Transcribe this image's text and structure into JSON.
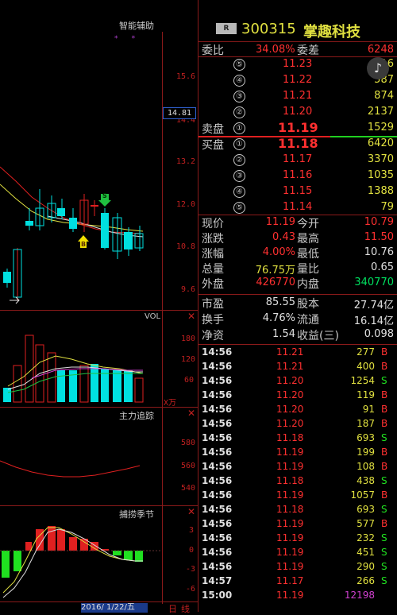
{
  "stock": {
    "badge": "R",
    "code": "300315",
    "name": "掌趣科技"
  },
  "weibi": {
    "label1": "委比",
    "pct": "34.08%",
    "label2": "委差",
    "diff": "6248"
  },
  "sell": [
    {
      "lvl": "⑤",
      "price": "11.23",
      "vol": "116"
    },
    {
      "lvl": "④",
      "price": "11.22",
      "vol": "587"
    },
    {
      "lvl": "③",
      "price": "11.21",
      "vol": "874"
    },
    {
      "lvl": "②",
      "price": "11.20",
      "vol": "2137"
    },
    {
      "lvl": "①",
      "price": "11.19",
      "vol": "1529",
      "label": "卖盘"
    }
  ],
  "buy": [
    {
      "lvl": "①",
      "price": "11.18",
      "vol": "6420",
      "label": "买盘"
    },
    {
      "lvl": "②",
      "price": "11.17",
      "vol": "3370"
    },
    {
      "lvl": "③",
      "price": "11.16",
      "vol": "1035"
    },
    {
      "lvl": "④",
      "price": "11.15",
      "vol": "1388"
    },
    {
      "lvl": "⑤",
      "price": "11.14",
      "vol": "79"
    }
  ],
  "quote": [
    {
      "l1": "现价",
      "v1": "11.19",
      "l2": "今开",
      "v2": "10.79"
    },
    {
      "l1": "涨跌",
      "v1": "0.43",
      "l2": "最高",
      "v2": "11.50"
    },
    {
      "l1": "涨幅",
      "v1": "4.00%",
      "l2": "最低",
      "v2": "10.76"
    },
    {
      "l1": "总量",
      "v1": "76.75万",
      "l2": "量比",
      "v2": "0.65"
    },
    {
      "l1": "外盘",
      "v1": "426770",
      "l2": "内盘",
      "v2": "340770"
    }
  ],
  "fin": [
    {
      "l1": "市盈",
      "v1": "85.55",
      "l2": "股本",
      "v2": "27.74亿"
    },
    {
      "l1": "换手",
      "v1": "4.76%",
      "l2": "流通",
      "v2": "16.14亿"
    },
    {
      "l1": "净资",
      "v1": "1.54",
      "l2": "收益(三)",
      "v2": "0.098"
    }
  ],
  "trades": [
    {
      "t": "14:56",
      "p": "11.21",
      "v": "277",
      "s": "B"
    },
    {
      "t": "14:56",
      "p": "11.21",
      "v": "400",
      "s": "B"
    },
    {
      "t": "14:56",
      "p": "11.20",
      "v": "1254",
      "s": "S"
    },
    {
      "t": "14:56",
      "p": "11.20",
      "v": "119",
      "s": "B"
    },
    {
      "t": "14:56",
      "p": "11.20",
      "v": "91",
      "s": "B"
    },
    {
      "t": "14:56",
      "p": "11.20",
      "v": "187",
      "s": "B"
    },
    {
      "t": "14:56",
      "p": "11.18",
      "v": "693",
      "s": "S"
    },
    {
      "t": "14:56",
      "p": "11.19",
      "v": "199",
      "s": "B"
    },
    {
      "t": "14:56",
      "p": "11.19",
      "v": "108",
      "s": "B"
    },
    {
      "t": "14:56",
      "p": "11.18",
      "v": "438",
      "s": "S"
    },
    {
      "t": "14:56",
      "p": "11.19",
      "v": "1057",
      "s": "B"
    },
    {
      "t": "14:56",
      "p": "11.18",
      "v": "693",
      "s": "S"
    },
    {
      "t": "14:56",
      "p": "11.19",
      "v": "577",
      "s": "B"
    },
    {
      "t": "14:56",
      "p": "11.19",
      "v": "232",
      "s": "S"
    },
    {
      "t": "14:56",
      "p": "11.19",
      "v": "451",
      "s": "S"
    },
    {
      "t": "14:56",
      "p": "11.19",
      "v": "290",
      "s": "S"
    },
    {
      "t": "14:57",
      "p": "11.17",
      "v": "266",
      "s": "S"
    },
    {
      "t": "15:00",
      "p": "11.19",
      "v": "12198",
      "s": ""
    }
  ],
  "chart": {
    "title": "智能辅助",
    "price_axis": [
      "15.6",
      "14.4",
      "13.2",
      "12.0",
      "10.8",
      "9.6"
    ],
    "price_box": "14.81",
    "vol_title": "VOL",
    "vol_axis": [
      "180",
      "120",
      "60"
    ],
    "vol_unit": "X万",
    "zl_title": "主力追踪",
    "zl_axis": [
      "580",
      "560",
      "540"
    ],
    "season_title": "捕捞季节",
    "season_axis": [
      "3",
      "0",
      "-3",
      "-6"
    ],
    "date": "2016/ 1/22/五",
    "bottom_tabs": [
      "日",
      "线"
    ],
    "mark_s": "S",
    "mark_b": "B"
  }
}
